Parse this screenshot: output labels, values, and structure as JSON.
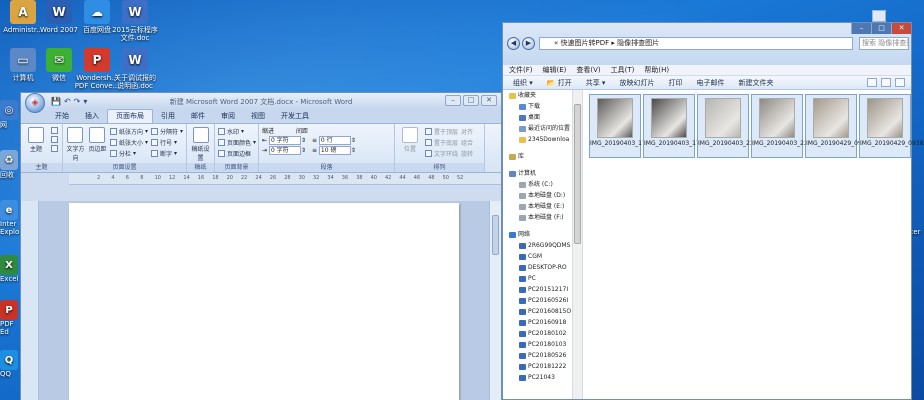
{
  "desktop": {
    "icons": [
      {
        "label": "Administr...",
        "glyph": "A",
        "color": "#d9a441",
        "icon": "folder-user-icon"
      },
      {
        "label": "Word 2007",
        "glyph": "W",
        "color": "#2b5fb3",
        "icon": "word-icon"
      },
      {
        "label": "百度网盘",
        "glyph": "☁",
        "color": "#2f8de4",
        "icon": "baidu-netdisk-icon"
      },
      {
        "label": "2015云标程序文件.doc",
        "glyph": "W",
        "color": "#3d6fc6",
        "icon": "word-document-icon"
      },
      {
        "label": "计算机",
        "glyph": "▭",
        "color": "#5c88c5",
        "icon": "computer-icon"
      },
      {
        "label": "微信",
        "glyph": "✉",
        "color": "#3cb034",
        "icon": "wechat-icon"
      },
      {
        "label": "Wondersh... PDF Conve...",
        "glyph": "P",
        "color": "#d23a2e",
        "icon": "pdf-converter-icon"
      },
      {
        "label": "关于调试报的说明函.doc",
        "glyph": "W",
        "color": "#3d6fc6",
        "icon": "word-document-icon"
      }
    ],
    "left_edge": [
      {
        "label": "网",
        "glyph": "◎",
        "color": "#3a7bd0",
        "icon": "network-icon"
      },
      {
        "label": "回收",
        "glyph": "♻",
        "color": "#7aa6d8",
        "icon": "recycle-bin-icon"
      },
      {
        "label": "Inter Explo",
        "glyph": "e",
        "color": "#3c8ee0",
        "icon": "internet-explorer-icon"
      },
      {
        "label": "Excel",
        "glyph": "X",
        "color": "#2e8b3e",
        "icon": "excel-icon"
      },
      {
        "label": "PDF Ed",
        "glyph": "P",
        "color": "#c83227",
        "icon": "pdf-editor-icon"
      },
      {
        "label": "QQ",
        "glyph": "Q",
        "color": "#1d8fe2",
        "icon": "qq-icon"
      }
    ],
    "right_edge": [
      {
        "label": "Inter"
      }
    ]
  },
  "word": {
    "title": "新建 Microsoft Word 2007 文档.docx - Microsoft Word",
    "quick_access": [
      "💾",
      "↶",
      "↷",
      "▾"
    ],
    "tabs": [
      "开始",
      "插入",
      "页面布局",
      "引用",
      "邮件",
      "审阅",
      "视图",
      "开发工具"
    ],
    "active_tab": 2,
    "groups": {
      "theme": {
        "name": "主题",
        "big": "主题",
        "small": [
          "颜色",
          "字体",
          "效果"
        ]
      },
      "page_setup": {
        "name": "页面设置",
        "big": [
          "文字方向",
          "页边距"
        ],
        "small": [
          "纸张方向",
          "纸张大小",
          "分栏"
        ],
        "small2": [
          "分隔符",
          "行号",
          "断字"
        ]
      },
      "draft": {
        "name": "稿纸",
        "big": "稿纸设置"
      },
      "page_bg": {
        "name": "页面背景",
        "small": [
          "水印",
          "页面颜色",
          "页面边框"
        ]
      },
      "indent": {
        "header": "缩进",
        "left": "0 字符",
        "right": "0 字符"
      },
      "spacing": {
        "header": "间距",
        "before": "0 行",
        "after": "10 磅"
      },
      "paragraph": {
        "name": "段落"
      },
      "arrange": {
        "name": "排列",
        "position": "位置",
        "items": [
          "置于顶层",
          "置于底层",
          "文字环绕"
        ],
        "items2": [
          "对齐",
          "组合",
          "旋转"
        ]
      }
    },
    "ruler_ticks": [
      "2",
      "4",
      "6",
      "8",
      "10",
      "12",
      "14",
      "16",
      "18",
      "20",
      "22",
      "24",
      "26",
      "28",
      "30",
      "32",
      "34",
      "36",
      "38",
      "40",
      "42",
      "44",
      "46",
      "48",
      "50",
      "52"
    ]
  },
  "explorer": {
    "address": "« 快速图片转PDF ▸ 隐像排查图片",
    "search_placeholder": "搜索 隐像排查图片",
    "menu": [
      "文件(F)",
      "编辑(E)",
      "查看(V)",
      "工具(T)",
      "帮助(H)"
    ],
    "toolbar": [
      "组织 ▾",
      "📂 打开",
      "共享 ▾",
      "放映幻灯片",
      "打印",
      "电子邮件",
      "新建文件夹"
    ],
    "nav": [
      {
        "label": "收藏夹",
        "indent": false,
        "color": "#e8c14a",
        "icon": "favorites-star-icon"
      },
      {
        "label": "下载",
        "indent": true,
        "color": "#5a8ad0",
        "icon": "downloads-icon"
      },
      {
        "label": "桌面",
        "indent": true,
        "color": "#4a78c0",
        "icon": "desktop-icon"
      },
      {
        "label": "最近访问的位置",
        "indent": true,
        "color": "#7a9cc8",
        "icon": "recent-places-icon"
      },
      {
        "label": "2345Downloa",
        "indent": true,
        "color": "#e8c14a",
        "icon": "folder-icon"
      },
      {
        "gap": true
      },
      {
        "label": "库",
        "indent": false,
        "color": "#c9a94e",
        "icon": "libraries-icon"
      },
      {
        "gap": true
      },
      {
        "label": "计算机",
        "indent": false,
        "color": "#5c88c5",
        "icon": "computer-icon"
      },
      {
        "label": "系统 (C:)",
        "indent": true,
        "color": "#9aa6b4",
        "icon": "drive-icon"
      },
      {
        "label": "本地磁盘 (D:)",
        "indent": true,
        "color": "#9aa6b4",
        "icon": "drive-icon"
      },
      {
        "label": "本地磁盘 (E:)",
        "indent": true,
        "color": "#9aa6b4",
        "icon": "drive-icon"
      },
      {
        "label": "本地磁盘 (F:)",
        "indent": true,
        "color": "#9aa6b4",
        "icon": "drive-icon"
      },
      {
        "gap": true
      },
      {
        "label": "网络",
        "indent": false,
        "color": "#3a7bd0",
        "icon": "network-icon"
      },
      {
        "label": "2R6G99QDMS",
        "indent": true,
        "color": "#3a6bb8",
        "icon": "network-computer-icon"
      },
      {
        "label": "CGM",
        "indent": true,
        "color": "#3a6bb8",
        "icon": "network-computer-icon"
      },
      {
        "label": "DESKTOP-RO",
        "indent": true,
        "color": "#3a6bb8",
        "icon": "network-computer-icon"
      },
      {
        "label": "PC",
        "indent": true,
        "color": "#3a6bb8",
        "icon": "network-computer-icon"
      },
      {
        "label": "PC20151217I",
        "indent": true,
        "color": "#3a6bb8",
        "icon": "network-computer-icon"
      },
      {
        "label": "PC20160526I",
        "indent": true,
        "color": "#3a6bb8",
        "icon": "network-computer-icon"
      },
      {
        "label": "PC20160815O",
        "indent": true,
        "color": "#3a6bb8",
        "icon": "network-computer-icon"
      },
      {
        "label": "PC20160918",
        "indent": true,
        "color": "#3a6bb8",
        "icon": "network-computer-icon"
      },
      {
        "label": "PC20180102",
        "indent": true,
        "color": "#3a6bb8",
        "icon": "network-computer-icon"
      },
      {
        "label": "PC20180103",
        "indent": true,
        "color": "#3a6bb8",
        "icon": "network-computer-icon"
      },
      {
        "label": "PC20180526",
        "indent": true,
        "color": "#3a6bb8",
        "icon": "network-computer-icon"
      },
      {
        "label": "PC20181222",
        "indent": true,
        "color": "#3a6bb8",
        "icon": "network-computer-icon"
      },
      {
        "label": "PC21043",
        "indent": true,
        "color": "#3a6bb8",
        "icon": "network-computer-icon"
      }
    ],
    "files": [
      {
        "name": "IMG_20190403_170042.jpg",
        "color": "#5b5b5b"
      },
      {
        "name": "IMG_20190403_170054.jpg",
        "color": "#4a4a4a"
      },
      {
        "name": "IMG_20190403_222611.jpg",
        "color": "#b8b6b2"
      },
      {
        "name": "IMG_20190403_222622.jpg",
        "color": "#8e8a84"
      },
      {
        "name": "IMG_20190429_093813.jpg",
        "color": "#a49a8e"
      },
      {
        "name": "IMG_20190429_093832.jpg",
        "color": "#9c9488"
      }
    ]
  }
}
